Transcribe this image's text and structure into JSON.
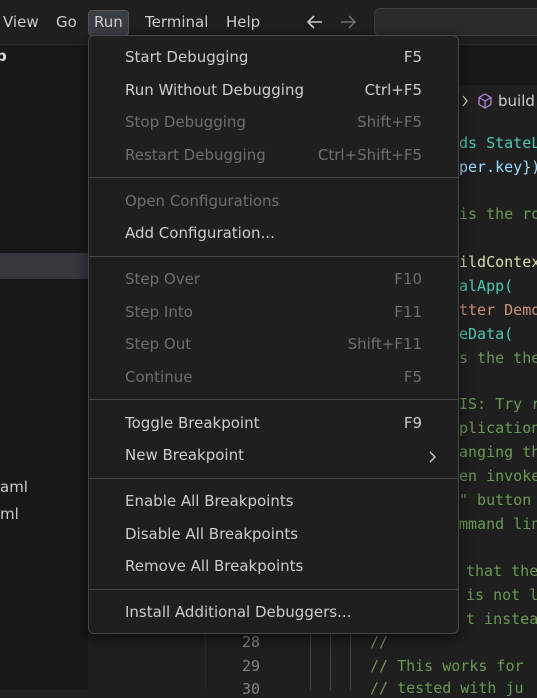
{
  "menubar": {
    "items": [
      {
        "label": "View"
      },
      {
        "label": "Go"
      },
      {
        "label": "Run"
      },
      {
        "label": "Terminal"
      },
      {
        "label": "Help"
      }
    ],
    "active_index": 2
  },
  "explorer": {
    "header_fragment": "p",
    "files": [
      {
        "label": "aml"
      },
      {
        "label": "ml"
      }
    ]
  },
  "breadcrumb": {
    "label": "build",
    "icon": "cube-icon"
  },
  "run_menu": {
    "items": [
      {
        "label": "Start Debugging",
        "shortcut": "F5",
        "enabled": true
      },
      {
        "label": "Run Without Debugging",
        "shortcut": "Ctrl+F5",
        "enabled": true
      },
      {
        "label": "Stop Debugging",
        "shortcut": "Shift+F5",
        "enabled": false
      },
      {
        "label": "Restart Debugging",
        "shortcut": "Ctrl+Shift+F5",
        "enabled": false
      },
      {
        "label": "Open Configurations",
        "shortcut": "",
        "enabled": false
      },
      {
        "label": "Add Configuration...",
        "shortcut": "",
        "enabled": true
      },
      {
        "label": "Step Over",
        "shortcut": "F10",
        "enabled": false
      },
      {
        "label": "Step Into",
        "shortcut": "F11",
        "enabled": false
      },
      {
        "label": "Step Out",
        "shortcut": "Shift+F11",
        "enabled": false
      },
      {
        "label": "Continue",
        "shortcut": "F5",
        "enabled": false
      },
      {
        "label": "Toggle Breakpoint",
        "shortcut": "F9",
        "enabled": true
      },
      {
        "label": "New Breakpoint",
        "shortcut": "",
        "enabled": true,
        "submenu": true
      },
      {
        "label": "Enable All Breakpoints",
        "shortcut": "",
        "enabled": true
      },
      {
        "label": "Disable All Breakpoints",
        "shortcut": "",
        "enabled": true
      },
      {
        "label": "Remove All Breakpoints",
        "shortcut": "",
        "enabled": true
      },
      {
        "label": "Install Additional Debuggers...",
        "shortcut": "",
        "enabled": true
      }
    ]
  },
  "code": {
    "lines": [
      {
        "text": "ds StateL",
        "kind": "mixed"
      },
      {
        "text": "per.key})",
        "kind": "mixed"
      },
      {
        "text": "is the ro",
        "kind": "comment"
      },
      {
        "text": "ildContex",
        "kind": "mixed"
      },
      {
        "text": "alApp(",
        "kind": "mixed"
      },
      {
        "text": "tter Demo",
        "kind": "str"
      },
      {
        "text": "eData(",
        "kind": "mixed"
      },
      {
        "text": "s the the",
        "kind": "comment"
      },
      {
        "text": "IS: Try r",
        "kind": "comment"
      },
      {
        "text": "plication",
        "kind": "comment"
      },
      {
        "text": "anging th",
        "kind": "comment"
      },
      {
        "text": "en invoke",
        "kind": "comment"
      },
      {
        "text": "\" button",
        "kind": "comment"
      },
      {
        "text": "mmand lin",
        "kind": "comment"
      },
      {
        "text": "that the",
        "kind": "comment"
      },
      {
        "text": "is not lo",
        "kind": "comment"
      },
      {
        "text": "t instead",
        "kind": "comment"
      },
      {
        "text": "//",
        "kind": "comment"
      },
      {
        "text": "// This works for",
        "kind": "comment"
      },
      {
        "text": "// tested with ju",
        "kind": "comment"
      }
    ],
    "line_numbers": [
      "28",
      "29",
      "30"
    ]
  },
  "colors": {
    "menu_bg": "#1f1f1f",
    "menu_border": "#454545",
    "text": "#cccccc",
    "disabled_text": "#6e6e6e",
    "comment": "#6a9955"
  }
}
